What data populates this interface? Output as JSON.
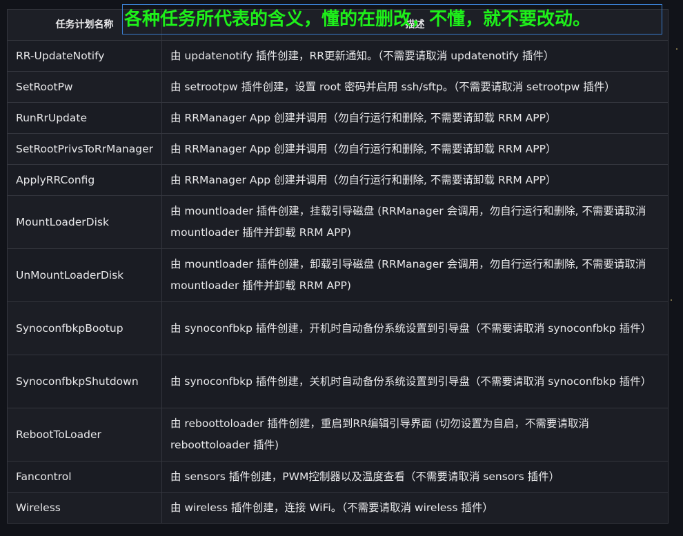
{
  "overlay_title": "各种任务所代表的含义，懂的在删改，不懂，就不要改动。",
  "table": {
    "headers": [
      "任务计划名称",
      "描述"
    ],
    "rows": [
      {
        "name": "RR-UpdateNotify",
        "desc": "由 updatenotify 插件创建，RR更新通知。（不需要请取消 updatenotify 插件）"
      },
      {
        "name": "SetRootPw",
        "desc": "由 setrootpw 插件创建，设置 root 密码并启用 ssh/sftp。（不需要请取消 setrootpw 插件）"
      },
      {
        "name": "RunRrUpdate",
        "desc": "由 RRManager App 创建并调用（勿自行运行和删除, 不需要请卸载 RRM APP）"
      },
      {
        "name": "SetRootPrivsToRrManager",
        "desc": "由 RRManager App 创建并调用（勿自行运行和删除, 不需要请卸载 RRM APP）"
      },
      {
        "name": "ApplyRRConfig",
        "desc": "由 RRManager App 创建并调用（勿自行运行和删除, 不需要请卸载 RRM APP）"
      },
      {
        "name": "MountLoaderDisk",
        "desc": "由 mountloader 插件创建，挂载引导磁盘 (RRManager 会调用，勿自行运行和删除, 不需要请取消 mountloader 插件并卸载 RRM APP)"
      },
      {
        "name": "UnMountLoaderDisk",
        "desc": "由 mountloader 插件创建，卸载引导磁盘 (RRManager 会调用，勿自行运行和删除, 不需要请取消 mountloader 插件并卸载 RRM APP)"
      },
      {
        "name": "SynoconfbkpBootup",
        "desc": "由 synoconfbkp 插件创建，开机时自动备份系统设置到引导盘（不需要请取消 synoconfbkp 插件）"
      },
      {
        "name": "SynoconfbkpShutdown",
        "desc": "由 synoconfbkp 插件创建，关机时自动备份系统设置到引导盘（不需要请取消 synoconfbkp 插件）"
      },
      {
        "name": "RebootToLoader",
        "desc": "由 reboottoloader 插件创建，重启到RR编辑引导界面 (切勿设置为自启，不需要请取消 reboottoloader 插件)"
      },
      {
        "name": "Fancontrol",
        "desc": "由 sensors 插件创建，PWM控制器以及温度查看（不需要请取消 sensors 插件）"
      },
      {
        "name": "Wireless",
        "desc": "由 wireless 插件创建，连接 WiFi。（不需要请取消 wireless 插件）"
      }
    ]
  },
  "colors": {
    "overlay_text": "#1ef01a",
    "overlay_border": "#3a7ed0",
    "background": "#111319"
  }
}
